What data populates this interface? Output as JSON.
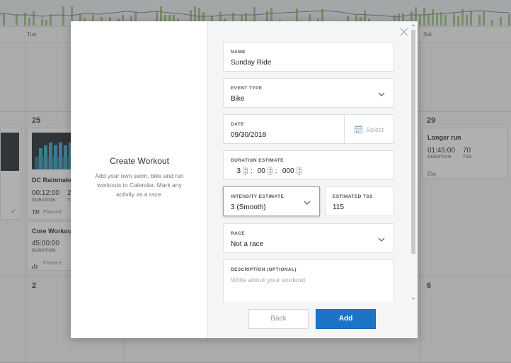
{
  "calendar": {
    "day_headers": {
      "tue": "Tue",
      "sat": "Sat"
    },
    "dates": {
      "d25": "25",
      "d29": "29",
      "d2": "2",
      "d6": "6"
    },
    "cards": [
      {
        "title": "DC Rainmake",
        "duration_value": "00:12:00",
        "duration_label": "DURATION",
        "tss_value_partial": "2",
        "tss_label_partial": "TS",
        "status": "Planned",
        "status_icon": "trainerroad-logo"
      },
      {
        "title": "Core Workou",
        "duration_value": "45:00:00",
        "duration_label": "DURATION",
        "status": "Planned",
        "status_icon": "bar-chart-icon"
      },
      {
        "title": "Longer run",
        "duration_value": "01:45:00",
        "duration_label": "DURATION",
        "tss_value": "70",
        "tss_label": "TSS",
        "status_icon": "run-shoe-icon"
      }
    ],
    "bar_color": "#9cc07a",
    "line_color": "#6c7a86"
  },
  "modal": {
    "title": "Create Workout",
    "description": "Add your own swim, bike and run workouts to Calendar. Mark any activity as a race.",
    "fields": {
      "name": {
        "label": "NAME",
        "value": "Sunday Ride"
      },
      "event_type": {
        "label": "EVENT TYPE",
        "value": "Bike"
      },
      "date": {
        "label": "DATE",
        "value": "09/30/2018",
        "select_label": "Select"
      },
      "duration": {
        "label": "DURATION ESTIMATE",
        "hours": "3",
        "minutes": "00",
        "seconds": "000"
      },
      "intensity": {
        "label": "INTENSITY ESTIMATE",
        "value": "3 (Smooth)"
      },
      "tss": {
        "label": "ESTIMATED TSS",
        "value": "115"
      },
      "race": {
        "label": "RACE",
        "value": "Not a race"
      },
      "description": {
        "label": "DESCRIPTION (OPTIONAL)",
        "placeholder": "Write about your workout"
      }
    },
    "buttons": {
      "back": "Back",
      "add": "Add"
    },
    "accent_color": "#1d73c6"
  }
}
